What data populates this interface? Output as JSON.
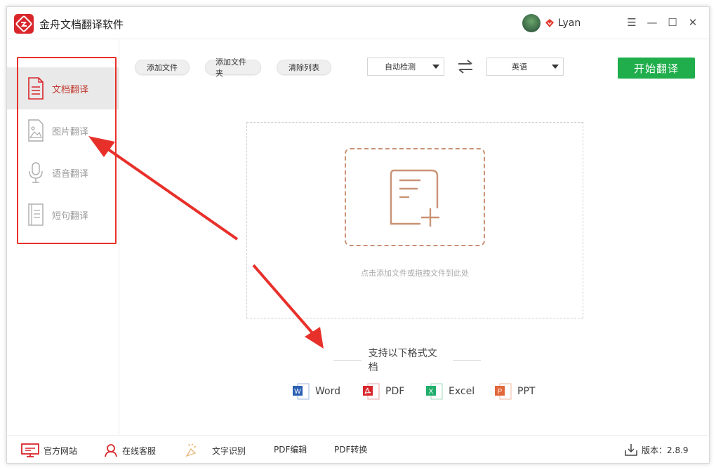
{
  "app": {
    "title": "金舟文档翻译软件",
    "username": "Lyan"
  },
  "window_controls": {
    "menu": "☰",
    "minimize": "—",
    "maximize": "☐",
    "close": "✕"
  },
  "sidebar": {
    "items": [
      {
        "label": "文档翻译",
        "icon": "document-icon",
        "active": true
      },
      {
        "label": "图片翻译",
        "icon": "image-icon",
        "active": false
      },
      {
        "label": "语音翻译",
        "icon": "microphone-icon",
        "active": false
      },
      {
        "label": "短句翻译",
        "icon": "text-page-icon",
        "active": false
      }
    ]
  },
  "toolbar": {
    "add_file": "添加文件",
    "add_folder": "添加文件夹",
    "clear_list": "清除列表",
    "source_lang": "自动检测",
    "target_lang": "英语",
    "start": "开始翻译"
  },
  "dropzone": {
    "hint": "点击添加文件或拖拽文件到此处"
  },
  "formats": {
    "title": "支持以下格式文档",
    "items": [
      {
        "label": "Word",
        "icon": "word-icon",
        "color": "#2b5fb3"
      },
      {
        "label": "PDF",
        "icon": "pdf-icon",
        "color": "#d9262b"
      },
      {
        "label": "Excel",
        "icon": "excel-icon",
        "color": "#1fae6b"
      },
      {
        "label": "PPT",
        "icon": "ppt-icon",
        "color": "#e2673a"
      }
    ]
  },
  "footer": {
    "website": "官方网站",
    "support": "在线客服",
    "ocr": "文字识别",
    "pdf_edit": "PDF编辑",
    "pdf_convert": "PDF转换",
    "version": "版本：2.8.9"
  },
  "colors": {
    "accent_red": "#d9262b",
    "start_green": "#1fae4b",
    "annotation_red": "#e8302a"
  }
}
